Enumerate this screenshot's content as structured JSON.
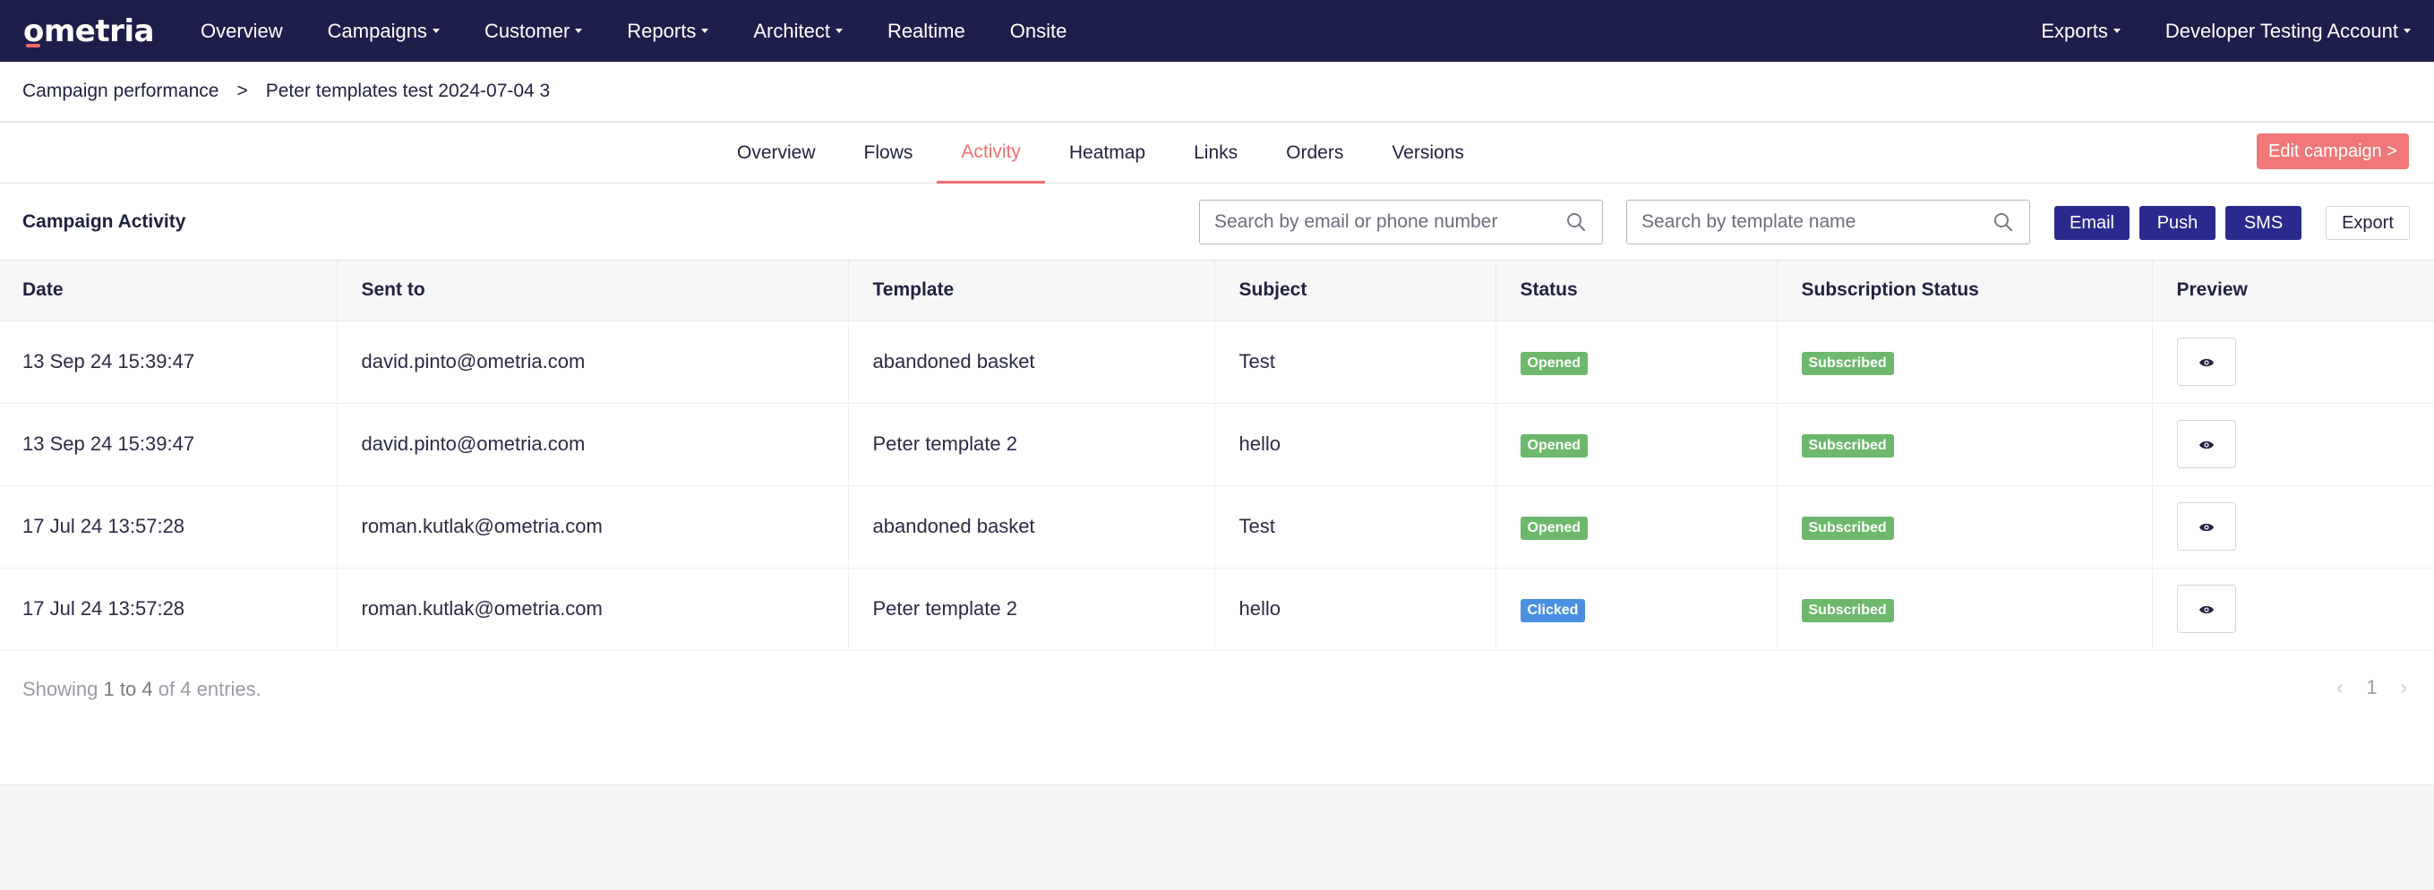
{
  "brand": {
    "logo_text": "ometria",
    "accent": "#f07070",
    "nav_bg": "#1e1e4b",
    "button_bg": "#2a2a8e"
  },
  "topnav": {
    "items": [
      {
        "label": "Overview",
        "dropdown": false
      },
      {
        "label": "Campaigns",
        "dropdown": true
      },
      {
        "label": "Customer",
        "dropdown": true
      },
      {
        "label": "Reports",
        "dropdown": true
      },
      {
        "label": "Architect",
        "dropdown": true
      },
      {
        "label": "Realtime",
        "dropdown": false
      },
      {
        "label": "Onsite",
        "dropdown": false
      }
    ],
    "exports_label": "Exports",
    "account_label": "Developer Testing Account"
  },
  "breadcrumb": {
    "parent": "Campaign performance",
    "separator": ">",
    "current": "Peter templates test 2024-07-04 3"
  },
  "tabs": [
    "Overview",
    "Flows",
    "Activity",
    "Heatmap",
    "Links",
    "Orders",
    "Versions"
  ],
  "active_tab": "Activity",
  "edit_campaign_label": "Edit campaign >",
  "toolbar": {
    "title": "Campaign Activity",
    "search_email_placeholder": "Search by email or phone number",
    "search_template_placeholder": "Search by template name",
    "email_label": "Email",
    "push_label": "Push",
    "sms_label": "SMS",
    "export_label": "Export"
  },
  "table": {
    "columns": [
      "Date",
      "Sent to",
      "Template",
      "Subject",
      "Status",
      "Subscription Status",
      "Preview"
    ],
    "rows": [
      {
        "date": "13 Sep 24 15:39:47",
        "sent_to": "david.pinto@ometria.com",
        "template": "abandoned basket",
        "subject": "Test",
        "status": "Opened",
        "status_color": "#6db86d",
        "subscription": "Subscribed"
      },
      {
        "date": "13 Sep 24 15:39:47",
        "sent_to": "david.pinto@ometria.com",
        "template": "Peter template 2",
        "subject": "hello",
        "status": "Opened",
        "status_color": "#6db86d",
        "subscription": "Subscribed"
      },
      {
        "date": "17 Jul 24 13:57:28",
        "sent_to": "roman.kutlak@ometria.com",
        "template": "abandoned basket",
        "subject": "Test",
        "status": "Opened",
        "status_color": "#6db86d",
        "subscription": "Subscribed"
      },
      {
        "date": "17 Jul 24 13:57:28",
        "sent_to": "roman.kutlak@ometria.com",
        "template": "Peter template 2",
        "subject": "hello",
        "status": "Clicked",
        "status_color": "#4a90e2",
        "subscription": "Subscribed"
      }
    ]
  },
  "footer": {
    "showing_prefix": "Showing",
    "range_start": "1",
    "range_to": "to",
    "range_end": "4",
    "of_label": "of",
    "total": "4",
    "entries_label": "entries.",
    "page": "1",
    "prev_icon": "chevron-left-icon",
    "next_icon": "chevron-right-icon"
  }
}
